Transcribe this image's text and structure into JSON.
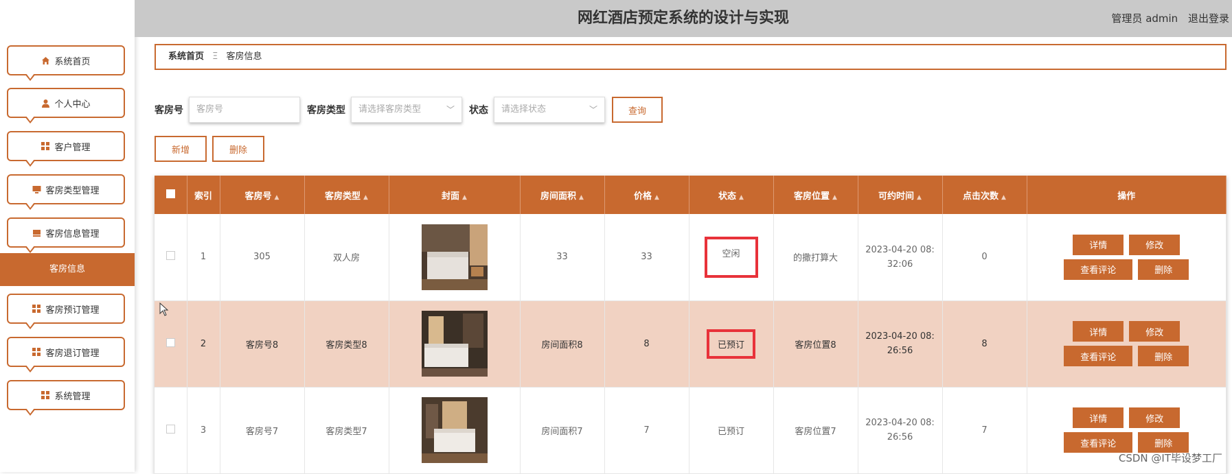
{
  "header": {
    "title": "网红酒店预定系统的设计与实现",
    "user_label": "管理员 admin",
    "logout_label": "退出登录"
  },
  "sidebar": {
    "items": [
      {
        "label": "系统首页",
        "icon": "home-icon"
      },
      {
        "label": "个人中心",
        "icon": "user-icon"
      },
      {
        "label": "客户管理",
        "icon": "grid-icon"
      },
      {
        "label": "客房类型管理",
        "icon": "monitor-icon"
      },
      {
        "label": "客房信息管理",
        "icon": "bed-icon"
      },
      {
        "label": "客房预订管理",
        "icon": "grid-icon"
      },
      {
        "label": "客房退订管理",
        "icon": "grid-icon"
      },
      {
        "label": "系统管理",
        "icon": "grid-icon"
      }
    ],
    "active_sub": "客房信息"
  },
  "breadcrumb": {
    "home": "系统首页",
    "separator": "Ξ",
    "current": "客房信息"
  },
  "search": {
    "room_no_label": "客房号",
    "room_no_placeholder": "客房号",
    "room_type_label": "客房类型",
    "room_type_placeholder": "请选择客房类型",
    "status_label": "状态",
    "status_placeholder": "请选择状态",
    "query_label": "查询"
  },
  "actions": {
    "add_label": "新增",
    "delete_label": "删除"
  },
  "table": {
    "columns": [
      "索引",
      "客房号",
      "客房类型",
      "封面",
      "房间面积",
      "价格",
      "状态",
      "客房位置",
      "可约时间",
      "点击次数",
      "操作"
    ],
    "rows": [
      {
        "index": "1",
        "room_no": "305",
        "room_type": "双人房",
        "area": "33",
        "price": "33",
        "status": "空闲",
        "location": "的撒打算大",
        "time_line1": "2023-04-20 08:",
        "time_line2": "32:06",
        "clicks": "0"
      },
      {
        "index": "2",
        "room_no": "客房号8",
        "room_type": "客房类型8",
        "area": "房间面积8",
        "price": "8",
        "status": "已预订",
        "location": "客房位置8",
        "time_line1": "2023-04-20 08:",
        "time_line2": "26:56",
        "clicks": "8"
      },
      {
        "index": "3",
        "room_no": "客房号7",
        "room_type": "客房类型7",
        "area": "房间面积7",
        "price": "7",
        "status": "已预订",
        "location": "客房位置7",
        "time_line1": "2023-04-20 08:",
        "time_line2": "26:56",
        "clicks": "7"
      }
    ],
    "ops": {
      "detail": "详情",
      "edit": "修改",
      "comments": "查看评论",
      "delete": "删除"
    }
  },
  "watermark": "CSDN @IT毕设梦工厂",
  "colors": {
    "accent": "#c8692f",
    "highlight_row": "#f1d2c2",
    "status_box": "#e8323a",
    "header_bg": "#c9c9c9"
  }
}
